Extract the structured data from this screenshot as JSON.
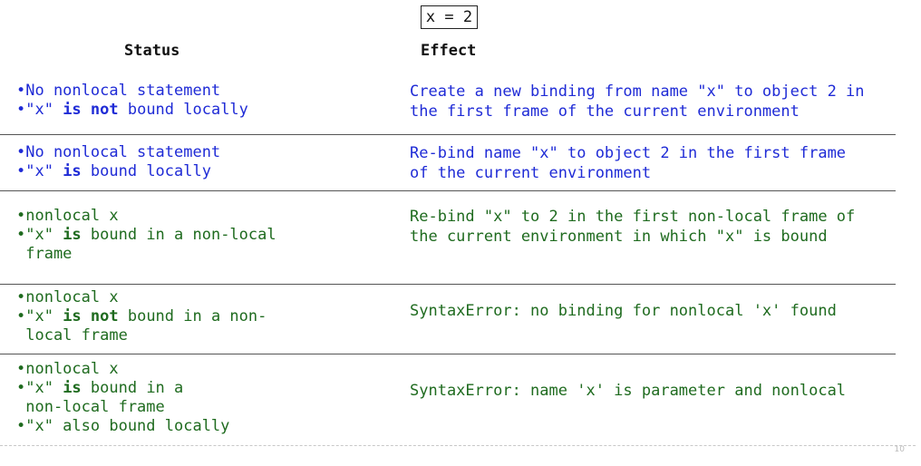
{
  "code": "x = 2",
  "headers": {
    "status": "Status",
    "effect": "Effect"
  },
  "rows": [
    {
      "status": [
        {
          "parts": [
            "•No nonlocal statement"
          ]
        },
        {
          "parts": [
            "•\"x\" ",
            "is not",
            " bound locally"
          ]
        }
      ],
      "effect": [
        "Create a new binding from name \"x\" to object 2 in",
        "the first frame of the current environment"
      ]
    },
    {
      "status": [
        {
          "parts": [
            "•No nonlocal statement"
          ]
        },
        {
          "parts": [
            "•\"x\" ",
            "is",
            " bound locally"
          ]
        }
      ],
      "effect": [
        "Re-bind name \"x\" to object 2 in the first frame",
        "of the current environment"
      ]
    },
    {
      "status": [
        {
          "parts": [
            "•nonlocal x"
          ]
        },
        {
          "parts": [
            "•\"x\" ",
            "is",
            " bound in a non-local"
          ]
        },
        {
          "parts": [
            " frame"
          ]
        }
      ],
      "effect": [
        "Re-bind \"x\" to 2 in the first non-local frame of",
        "the current environment in which \"x\" is bound"
      ]
    },
    {
      "status": [
        {
          "parts": [
            "•nonlocal x"
          ]
        },
        {
          "parts": [
            "•\"x\" ",
            "is not",
            " bound in a non-"
          ]
        },
        {
          "parts": [
            " local frame"
          ]
        }
      ],
      "effect": [
        "SyntaxError: no binding for nonlocal 'x' found"
      ]
    },
    {
      "status": [
        {
          "parts": [
            "•nonlocal x"
          ]
        },
        {
          "parts": [
            "•\"x\" ",
            "is",
            " bound in a"
          ]
        },
        {
          "parts": [
            " non-local frame"
          ]
        },
        {
          "parts": [
            "•\"x\" also bound locally"
          ]
        }
      ],
      "effect": [
        "SyntaxError: name 'x' is parameter and nonlocal"
      ]
    }
  ],
  "page_number": "10",
  "colors": {
    "row1": "#1f2bd6",
    "row2": "#1f2bd6",
    "row3": "#1f6b1f",
    "row4": "#1f6b1f",
    "row5": "#1f6b1f"
  }
}
